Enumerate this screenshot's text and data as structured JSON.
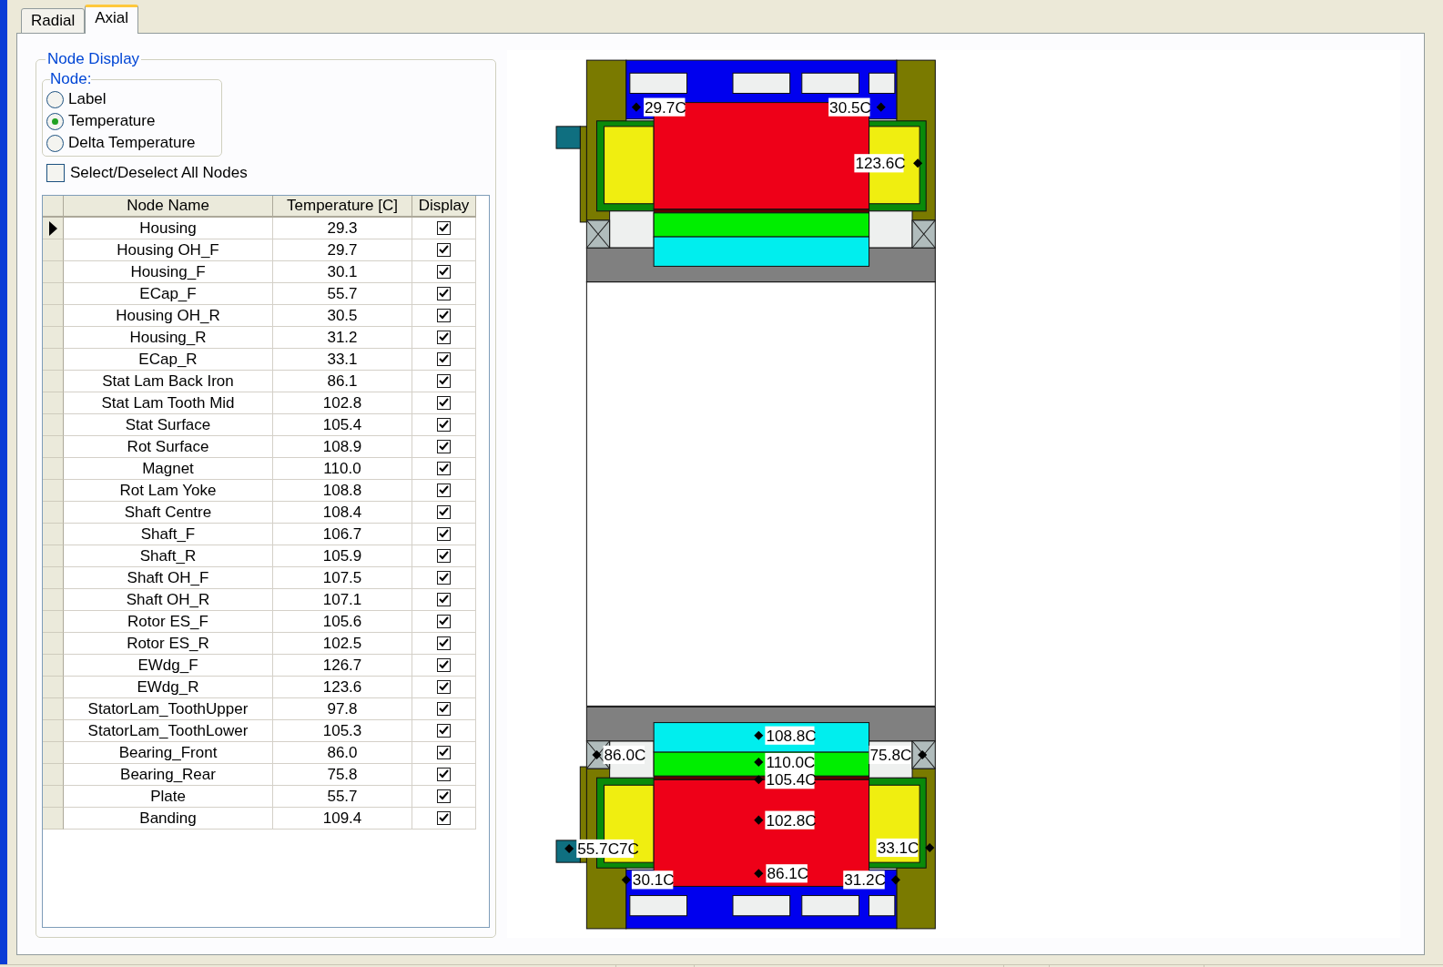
{
  "tabs": [
    {
      "label": "Radial",
      "selected": false
    },
    {
      "label": "Axial",
      "selected": true
    }
  ],
  "node_display": {
    "title": "Node Display",
    "node_group": {
      "title": "Node:",
      "options": [
        {
          "label": "Label",
          "selected": false
        },
        {
          "label": "Temperature",
          "selected": true
        },
        {
          "label": "Delta Temperature",
          "selected": false
        }
      ]
    },
    "select_all": {
      "label": "Select/Deselect All Nodes",
      "checked": false
    },
    "table": {
      "columns": [
        "Node Name",
        "Temperature [C]",
        "Display"
      ],
      "rows": [
        {
          "name": "Housing",
          "temperature": "29.3",
          "display": true,
          "selected": true
        },
        {
          "name": "Housing OH_F",
          "temperature": "29.7",
          "display": true,
          "selected": false
        },
        {
          "name": "Housing_F",
          "temperature": "30.1",
          "display": true,
          "selected": false
        },
        {
          "name": "ECap_F",
          "temperature": "55.7",
          "display": true,
          "selected": false
        },
        {
          "name": "Housing OH_R",
          "temperature": "30.5",
          "display": true,
          "selected": false
        },
        {
          "name": "Housing_R",
          "temperature": "31.2",
          "display": true,
          "selected": false
        },
        {
          "name": "ECap_R",
          "temperature": "33.1",
          "display": true,
          "selected": false
        },
        {
          "name": "Stat Lam Back Iron",
          "temperature": "86.1",
          "display": true,
          "selected": false
        },
        {
          "name": "Stat Lam Tooth Mid",
          "temperature": "102.8",
          "display": true,
          "selected": false
        },
        {
          "name": "Stat Surface",
          "temperature": "105.4",
          "display": true,
          "selected": false
        },
        {
          "name": "Rot Surface",
          "temperature": "108.9",
          "display": true,
          "selected": false
        },
        {
          "name": "Magnet",
          "temperature": "110.0",
          "display": true,
          "selected": false
        },
        {
          "name": "Rot Lam Yoke",
          "temperature": "108.8",
          "display": true,
          "selected": false
        },
        {
          "name": "Shaft Centre",
          "temperature": "108.4",
          "display": true,
          "selected": false
        },
        {
          "name": "Shaft_F",
          "temperature": "106.7",
          "display": true,
          "selected": false
        },
        {
          "name": "Shaft_R",
          "temperature": "105.9",
          "display": true,
          "selected": false
        },
        {
          "name": "Shaft OH_F",
          "temperature": "107.5",
          "display": true,
          "selected": false
        },
        {
          "name": "Shaft OH_R",
          "temperature": "107.1",
          "display": true,
          "selected": false
        },
        {
          "name": "Rotor ES_F",
          "temperature": "105.6",
          "display": true,
          "selected": false
        },
        {
          "name": "Rotor ES_R",
          "temperature": "102.5",
          "display": true,
          "selected": false
        },
        {
          "name": "EWdg_F",
          "temperature": "126.7",
          "display": true,
          "selected": false
        },
        {
          "name": "EWdg_R",
          "temperature": "123.6",
          "display": true,
          "selected": false
        },
        {
          "name": "StatorLam_ToothUpper",
          "temperature": "97.8",
          "display": true,
          "selected": false
        },
        {
          "name": "StatorLam_ToothLower",
          "temperature": "105.3",
          "display": true,
          "selected": false
        },
        {
          "name": "Bearing_Front",
          "temperature": "86.0",
          "display": true,
          "selected": false
        },
        {
          "name": "Bearing_Rear",
          "temperature": "75.8",
          "display": true,
          "selected": false
        },
        {
          "name": "Plate",
          "temperature": "55.7",
          "display": true,
          "selected": false
        },
        {
          "name": "Banding",
          "temperature": "109.4",
          "display": true,
          "selected": false
        }
      ]
    }
  },
  "diagram": {
    "labels": [
      "29.7C",
      "30.5C",
      "123.6C",
      "108.8C",
      "86.0C",
      "75.8C",
      "110.0C",
      "105.4C",
      "102.8C",
      "55.7C7C",
      "33.1C",
      "30.1C",
      "86.1C",
      "31.2C"
    ]
  }
}
